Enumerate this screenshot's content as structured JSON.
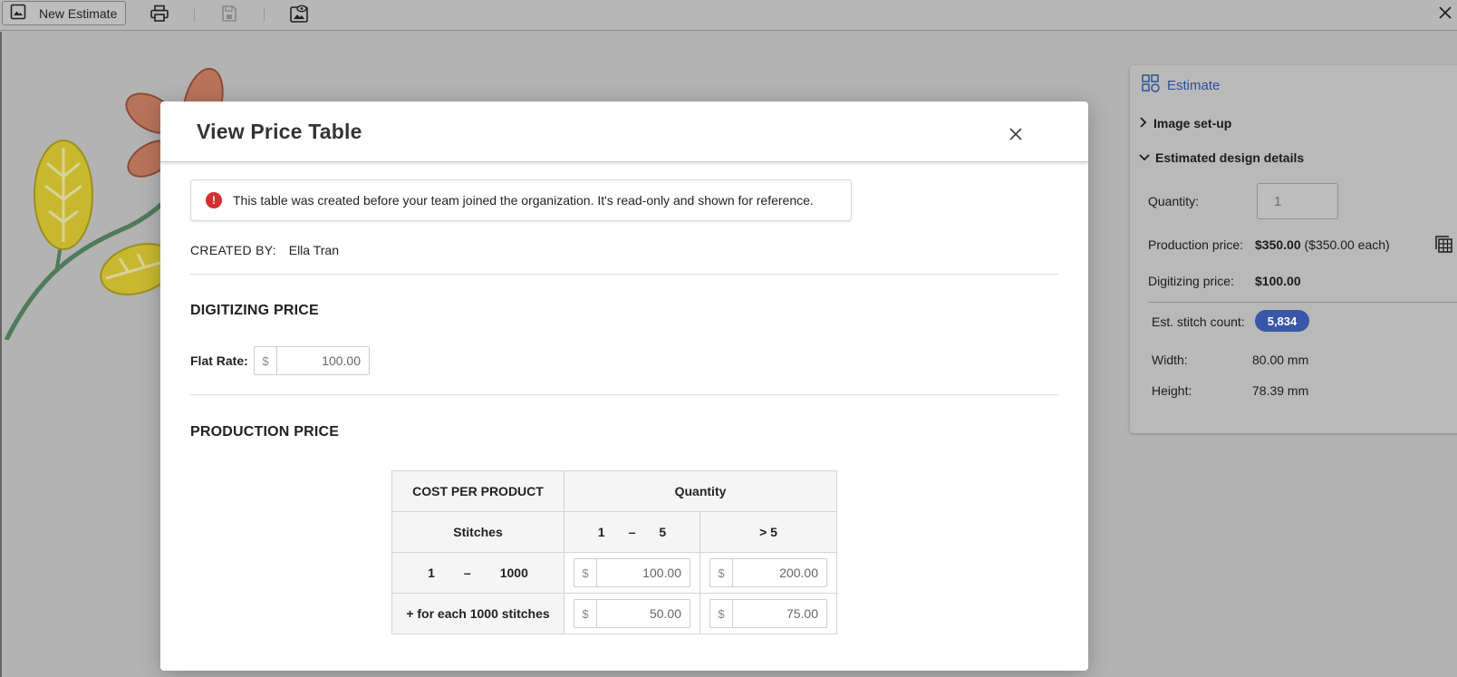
{
  "toolbar": {
    "new_estimate_label": "New Estimate",
    "icons": [
      "image-icon",
      "print-icon",
      "save-icon",
      "preview-icon",
      "close-icon"
    ]
  },
  "estimate_panel": {
    "title": "Estimate",
    "image_setup_label": "Image set-up",
    "details_label": "Estimated design details",
    "quantity_label": "Quantity:",
    "quantity_value": "1",
    "production_price_label": "Production price:",
    "production_price_value": "$350.00",
    "production_price_each": "($350.00 each)",
    "digitizing_price_label": "Digitizing price:",
    "digitizing_price_value": "$100.00",
    "stitch_count_label": "Est. stitch count:",
    "stitch_count_value": "5,834",
    "width_label": "Width:",
    "width_value": "80.00 mm",
    "height_label": "Height:",
    "height_value": "78.39 mm"
  },
  "modal": {
    "title": "View Price Table",
    "alert_text": "This table was created before your team joined the organization. It's read-only and shown for reference.",
    "created_by_label": "CREATED BY:",
    "created_by_value": "Ella Tran",
    "digitizing_title": "DIGITIZING PRICE",
    "flat_rate_label": "Flat Rate:",
    "currency_symbol": "$",
    "flat_rate_value": "100.00",
    "production_title": "PRODUCTION PRICE",
    "table": {
      "header_cost": "COST PER PRODUCT",
      "header_quantity": "Quantity",
      "header_stitches": "Stitches",
      "qty_ranges": [
        {
          "from": "1",
          "dash": "–",
          "to": "5"
        },
        {
          "label": "> 5"
        }
      ],
      "rows": [
        {
          "from": "1",
          "dash": "–",
          "to": "1000",
          "values": [
            "100.00",
            "200.00"
          ]
        },
        {
          "label": "+ for each 1000 stitches",
          "values": [
            "50.00",
            "75.00"
          ]
        }
      ]
    }
  },
  "colors": {
    "accent": "#2c4fa0",
    "badge": "#3a56a8",
    "alert": "#d32f2f"
  }
}
